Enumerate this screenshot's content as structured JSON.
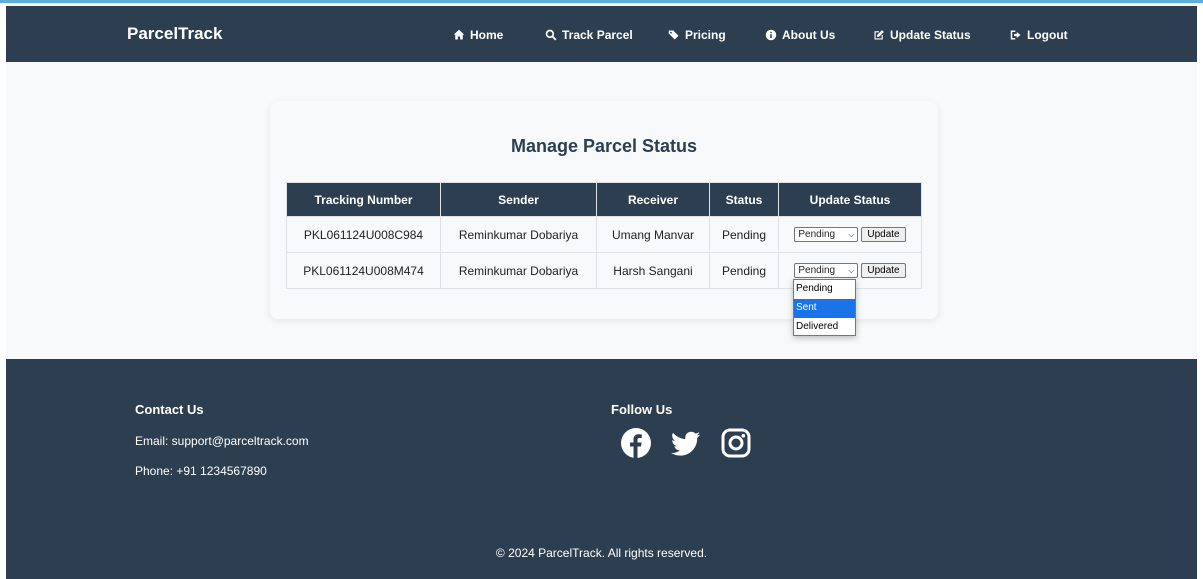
{
  "nav": {
    "brand": "ParcelTrack",
    "items": [
      {
        "label": "Home",
        "icon": "home-icon"
      },
      {
        "label": "Track Parcel",
        "icon": "search-icon"
      },
      {
        "label": "Pricing",
        "icon": "tags-icon"
      },
      {
        "label": "About Us",
        "icon": "info-icon"
      },
      {
        "label": "Update Status",
        "icon": "edit-icon"
      },
      {
        "label": "Logout",
        "icon": "logout-icon"
      }
    ]
  },
  "main": {
    "title": "Manage Parcel Status",
    "columns": [
      "Tracking Number",
      "Sender",
      "Receiver",
      "Status",
      "Update Status"
    ],
    "rows": [
      {
        "tracking": "PKL061124U008C984",
        "sender": "Reminkumar Dobariya",
        "receiver": "Umang Manvar",
        "status": "Pending",
        "select_value": "Pending",
        "button": "Update"
      },
      {
        "tracking": "PKL061124U008M474",
        "sender": "Reminkumar Dobariya",
        "receiver": "Harsh Sangani",
        "status": "Pending",
        "select_value": "Pending",
        "button": "Update"
      }
    ],
    "dropdown_options": [
      "Pending",
      "Sent",
      "Delivered"
    ],
    "dropdown_highlighted": "Sent"
  },
  "footer": {
    "contact_heading": "Contact Us",
    "email": "Email: support@parceltrack.com",
    "phone": "Phone: +91 1234567890",
    "follow_heading": "Follow Us",
    "social": [
      "facebook-icon",
      "twitter-icon",
      "instagram-icon"
    ],
    "copyright": "© 2024 ParcelTrack. All rights reserved."
  },
  "colors": {
    "navbar": "#2c3e50",
    "footer": "#2c3e50",
    "table_header": "#2c3e50",
    "title": "#2c3e50",
    "dropdown_highlight": "#1a73e8"
  }
}
